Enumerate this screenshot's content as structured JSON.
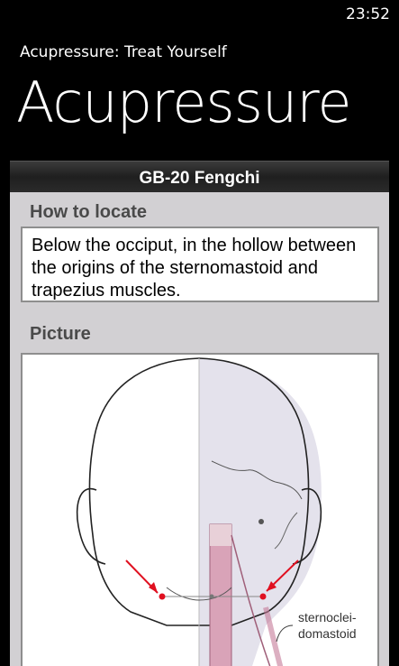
{
  "status": {
    "time": "23:52"
  },
  "app": {
    "title": "Acupressure: Treat Yourself"
  },
  "page": {
    "title": "Acupressure"
  },
  "point": {
    "name": "GB-20 Fengchi"
  },
  "locate": {
    "label": "How to locate",
    "text": "Below the occiput, in the hollow between the origins of the sternomastoid and trapezius muscles."
  },
  "picture": {
    "label": "Picture",
    "caption_line1": "sternoclei-",
    "caption_line2": "domastoid"
  }
}
